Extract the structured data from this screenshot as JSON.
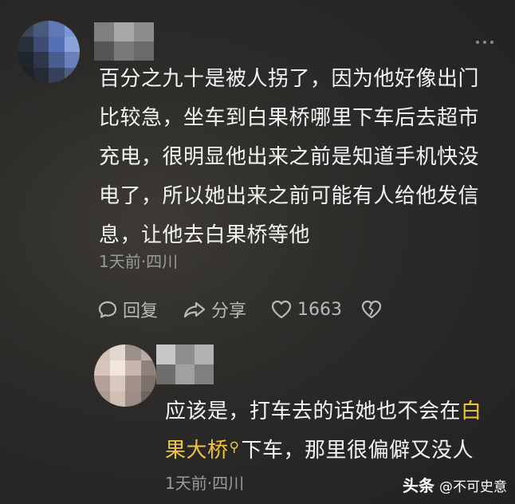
{
  "comments": [
    {
      "text": "百分之九十是被人拐了，因为他好像出门比较急，坐车到白果桥哪里下车后去超市充电，很明显他出来之前是知道手机快没电了，所以她出来之前可能有人给他发信息，让他去白果桥等他",
      "meta": "1天前·四川",
      "actions": {
        "reply_label": "回复",
        "share_label": "分享",
        "like_count": "1663",
        "reply_icon": "reply-icon",
        "share_icon": "share-icon",
        "like_icon": "heart-icon",
        "dislike_icon": "broken-heart-icon"
      },
      "more_icon": "more-dots-icon"
    },
    {
      "text_before": "应该是，打车去的话她也不会在",
      "highlight": "白果大桥",
      "highlight_icon": "search-icon",
      "text_after": "下车，那里很偏僻又没人",
      "meta": "1天前·四川"
    }
  ],
  "watermark": {
    "brand": "头条",
    "handle": "@不可史意"
  },
  "colors": {
    "background": "#2a2927",
    "text": "#f4f4f4",
    "meta": "#9a9a9a",
    "highlight": "#f3c53c",
    "icon": "#b9b9b9"
  }
}
